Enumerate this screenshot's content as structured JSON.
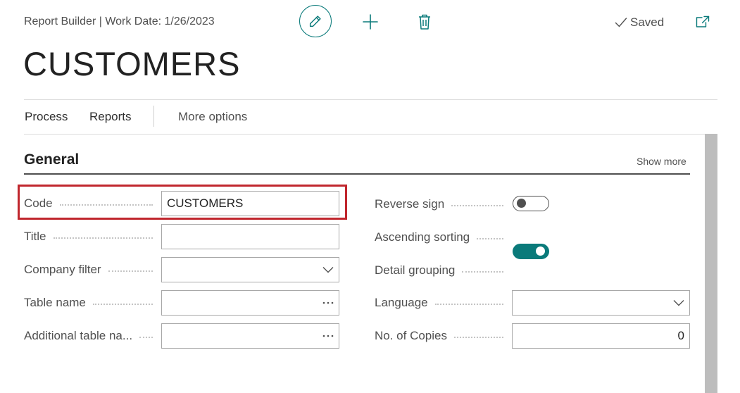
{
  "header": {
    "breadcrumb": "Report Builder | Work Date: 1/26/2023",
    "saved_label": "Saved",
    "page_title": "CUSTOMERS"
  },
  "toolbar": {
    "edit_icon": "pencil-icon",
    "new_icon": "plus-icon",
    "delete_icon": "trash-icon",
    "open_icon": "open-new-window-icon"
  },
  "menu": {
    "process": "Process",
    "reports": "Reports",
    "more_options": "More options"
  },
  "section": {
    "title": "General",
    "show_more": "Show more"
  },
  "fields": {
    "code": {
      "label": "Code",
      "value": "CUSTOMERS"
    },
    "title": {
      "label": "Title",
      "value": ""
    },
    "company_filter": {
      "label": "Company filter",
      "value": ""
    },
    "table_name": {
      "label": "Table name",
      "value": ""
    },
    "additional_table_name": {
      "label": "Additional table na...",
      "value": ""
    },
    "reverse_sign": {
      "label": "Reverse sign",
      "on": false
    },
    "ascending_sorting": {
      "label": "Ascending sorting",
      "on": true
    },
    "detail_grouping": {
      "label": "Detail grouping",
      "on": false
    },
    "language": {
      "label": "Language",
      "value": ""
    },
    "no_of_copies": {
      "label": "No. of Copies",
      "value": "0"
    }
  },
  "colors": {
    "accent": "#0a7a7a",
    "highlight": "#c0262d"
  }
}
